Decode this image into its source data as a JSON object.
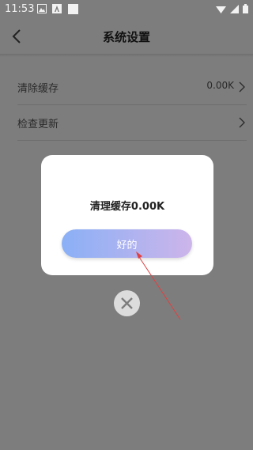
{
  "status_bar": {
    "time": "11:53"
  },
  "header": {
    "title": "系统设置"
  },
  "settings": [
    {
      "label": "清除缓存",
      "value": "0.00K"
    },
    {
      "label": "检查更新",
      "value": ""
    }
  ],
  "dialog": {
    "message": "清理缓存0.00K",
    "ok_label": "好的"
  },
  "colors": {
    "ok_gradient_start": "#8ab0f6",
    "ok_gradient_end": "#cdb5ea",
    "annotation": "#e04040"
  }
}
